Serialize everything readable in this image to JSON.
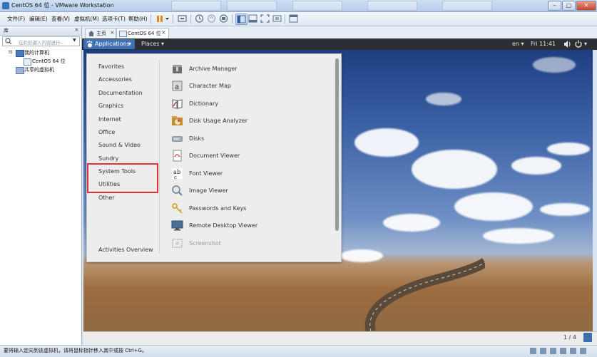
{
  "window": {
    "title": "CentOS 64 位 - VMware Workstation",
    "background_tabs": [
      "",
      "",
      "",
      "",
      "",
      ""
    ],
    "buttons": {
      "minimize": "–",
      "maximize": "□",
      "close": "✕"
    }
  },
  "menubar": {
    "items": [
      "文件(F)",
      "编辑(E)",
      "查看(V)",
      "虚拟机(M)",
      "选项卡(T)",
      "帮助(H)"
    ]
  },
  "library": {
    "title": "库",
    "close": "×",
    "search_placeholder": "在此处键入内容进行...",
    "search_icon": "search-icon",
    "tree": {
      "root": "我的计算机",
      "vm": "CentOS 64 位",
      "shared": "共享的虚拟机",
      "expander": "⊟"
    }
  },
  "vm_tabs": [
    {
      "label": "主页",
      "icon": "home-icon",
      "close": "×"
    },
    {
      "label": "CentOS 64 位",
      "icon": "vm-icon",
      "close": "×"
    }
  ],
  "gnome": {
    "applications": "Applications",
    "places": "Places",
    "locale": "en",
    "clock": "Fri 11:41",
    "caret": "▾"
  },
  "apps_menu": {
    "categories": [
      "Favorites",
      "Accessories",
      "Documentation",
      "Graphics",
      "Internet",
      "Office",
      "Sound & Video",
      "Sundry",
      "System Tools",
      "Utilities",
      "Other"
    ],
    "activities": "Activities Overview",
    "apps": [
      {
        "label": "Archive Manager",
        "icon": "archive-icon",
        "color": "#7a7a7a"
      },
      {
        "label": "Character Map",
        "icon": "character-map-icon",
        "color": "#8c8c8c"
      },
      {
        "label": "Dictionary",
        "icon": "dictionary-icon",
        "color": "#9e6b4b"
      },
      {
        "label": "Disk Usage Analyzer",
        "icon": "disk-usage-icon",
        "color": "#c58a2c"
      },
      {
        "label": "Disks",
        "icon": "disks-icon",
        "color": "#8f9aa3"
      },
      {
        "label": "Document Viewer",
        "icon": "document-viewer-icon",
        "color": "#d9534f"
      },
      {
        "label": "Font Viewer",
        "icon": "font-viewer-icon",
        "color": "#ffffff"
      },
      {
        "label": "Image Viewer",
        "icon": "image-viewer-icon",
        "color": "#6f7f8f"
      },
      {
        "label": "Passwords and Keys",
        "icon": "keys-icon",
        "color": "#d4a62a"
      },
      {
        "label": "Remote Desktop Viewer",
        "icon": "remote-desktop-icon",
        "color": "#4c6f9a"
      },
      {
        "label": "Screenshot",
        "icon": "screenshot-icon",
        "color": "#b7b7b7"
      }
    ]
  },
  "vm_footer": {
    "page": "1 / 4"
  },
  "statusbar": {
    "text": "要将输入定向到该虚拟机，请将鼠标指针移入其中或按 Ctrl+G。"
  },
  "colors": {
    "accent": "#3f73b6",
    "highlight": "#e0303a",
    "gnome_bar": "#2b2f33"
  }
}
